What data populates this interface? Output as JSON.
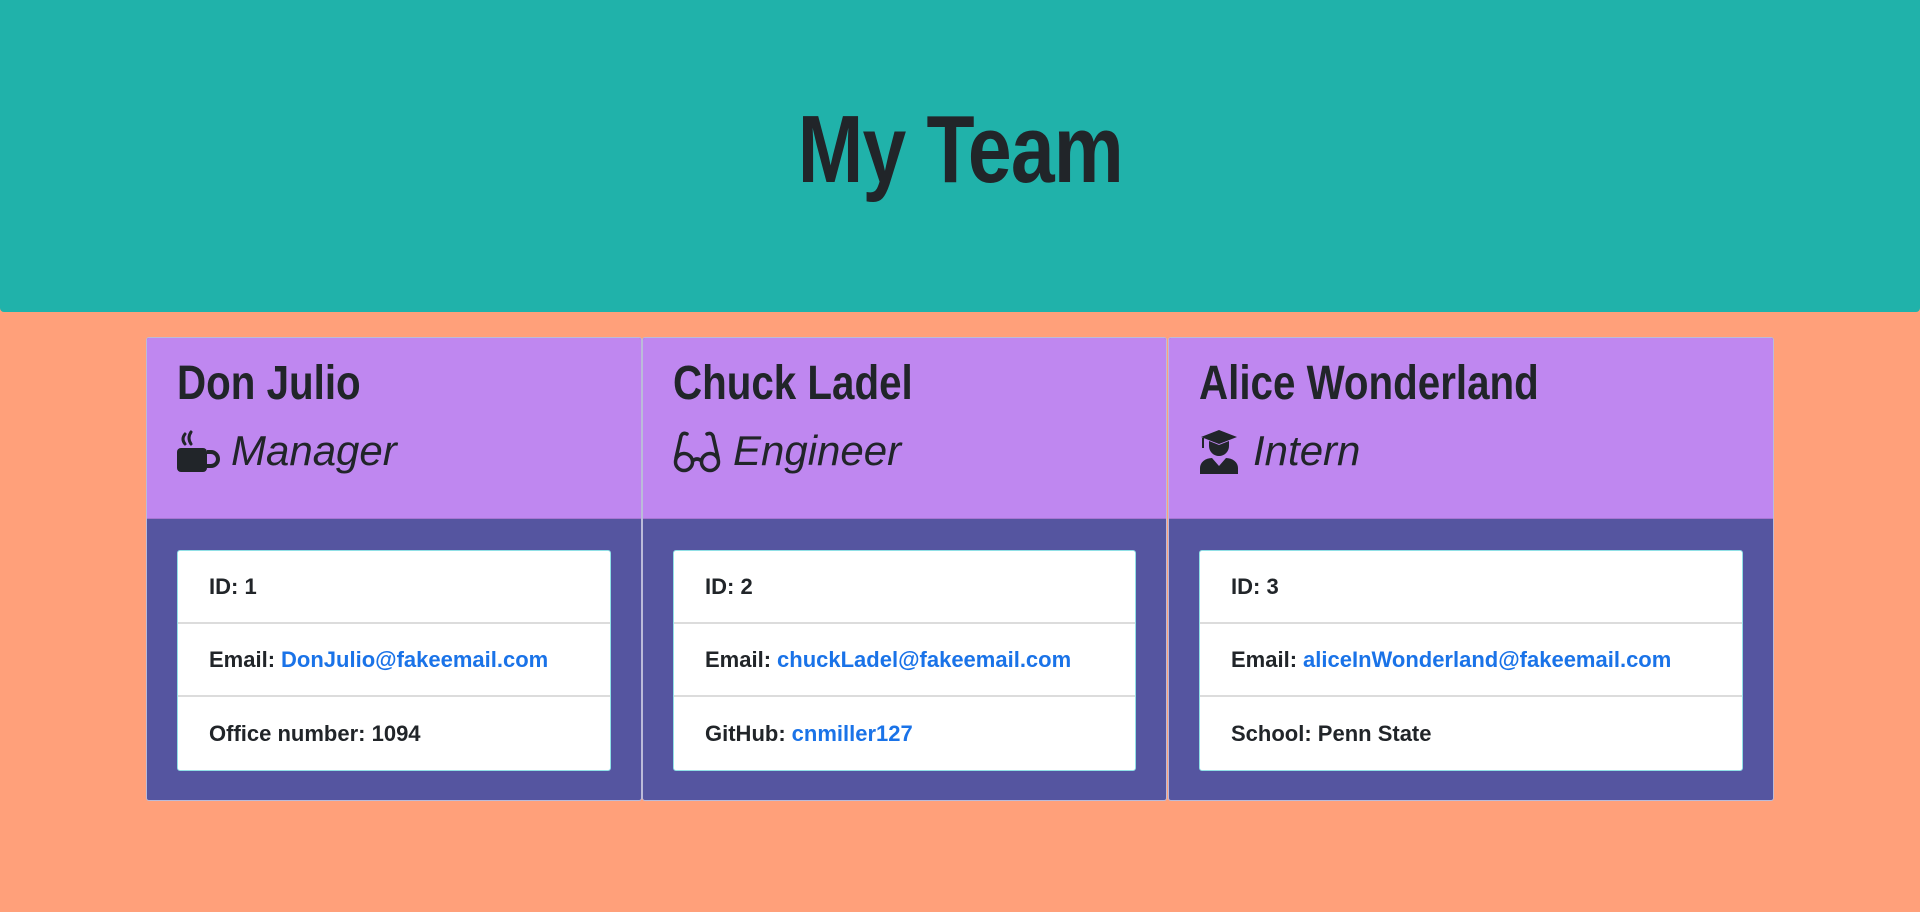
{
  "header": {
    "title": "My Team"
  },
  "colors": {
    "header_bg": "#20b2aa",
    "page_bg": "#ffa07a",
    "card_head_bg": "#bf87f0",
    "card_body_bg": "#5555a0",
    "link": "#1a73e8"
  },
  "cards": [
    {
      "name": "Don Julio",
      "role": "Manager",
      "icon": "mug-icon",
      "id_label": "ID:",
      "id_value": "1",
      "email_label": "Email:",
      "email": "DonJulio@fakeemail.com",
      "extra_label": "Office number:",
      "extra_value": "1094"
    },
    {
      "name": "Chuck Ladel",
      "role": "Engineer",
      "icon": "glasses-icon",
      "id_label": "ID:",
      "id_value": "2",
      "email_label": "Email:",
      "email": "chuckLadel@fakeemail.com",
      "extra_label": "GitHub:",
      "extra_value": "cnmiller127"
    },
    {
      "name": "Alice Wonderland",
      "role": "Intern",
      "icon": "graduate-icon",
      "id_label": "ID:",
      "id_value": "3",
      "email_label": "Email:",
      "email": "aliceInWonderland@fakeemail.com",
      "extra_label": "School:",
      "extra_value": "Penn State"
    }
  ]
}
